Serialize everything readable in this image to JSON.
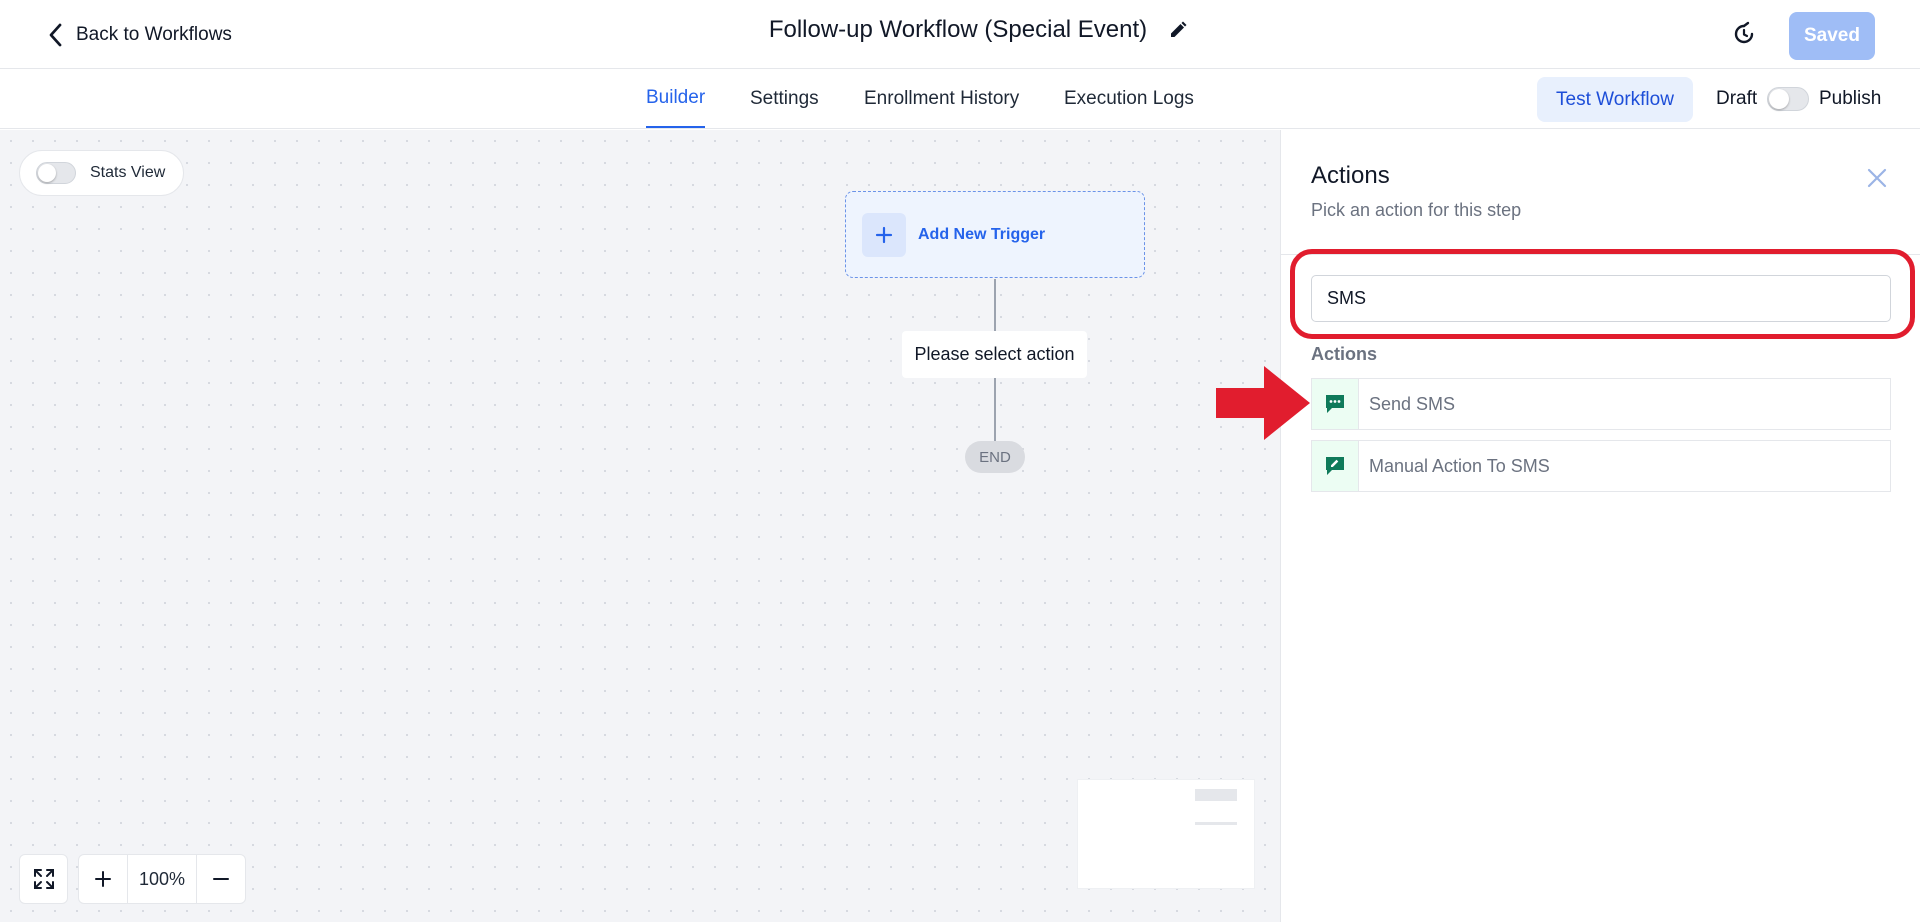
{
  "header": {
    "back_label": "Back to Workflows",
    "title": "Follow-up Workflow (Special Event)",
    "saved_label": "Saved"
  },
  "tabs": [
    {
      "label": "Builder",
      "active": true
    },
    {
      "label": "Settings",
      "active": false
    },
    {
      "label": "Enrollment History",
      "active": false
    },
    {
      "label": "Execution Logs",
      "active": false
    }
  ],
  "toolbar": {
    "test_workflow_label": "Test Workflow",
    "draft_label": "Draft",
    "publish_label": "Publish"
  },
  "canvas": {
    "stats_view_label": "Stats View",
    "add_trigger_label": "Add New Trigger",
    "select_action_label": "Please select action",
    "end_label": "END",
    "zoom_level": "100%"
  },
  "panel": {
    "title": "Actions",
    "subtitle": "Pick an action for this step",
    "search_value": "SMS",
    "section_label": "Actions",
    "items": [
      {
        "label": "Send SMS",
        "icon": "sms-chat-icon"
      },
      {
        "label": "Manual Action To SMS",
        "icon": "manual-sms-icon"
      }
    ]
  },
  "colors": {
    "accent": "#2563eb",
    "saved_button": "#9fbdf6",
    "action_icon": "#0f7a5a",
    "highlight": "#e11d2e"
  }
}
